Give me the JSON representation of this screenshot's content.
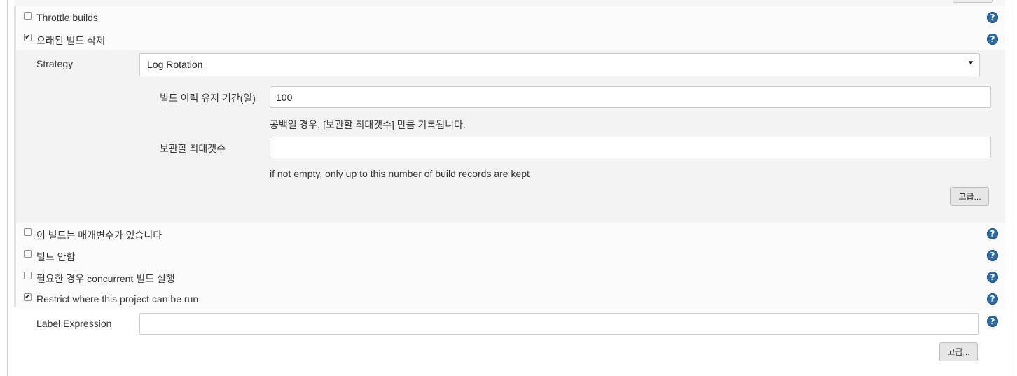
{
  "options": {
    "throttle_builds": {
      "label": "Throttle builds",
      "checked": false
    },
    "discard_old_builds": {
      "label": "오래된 빌드 삭제",
      "checked": true
    },
    "parameterized": {
      "label": "이 빌드는 매개변수가 있습니다",
      "checked": false
    },
    "disable_build": {
      "label": "빌드 안함",
      "checked": false
    },
    "concurrent_builds": {
      "label": "필요한 경우 concurrent 빌드 실행",
      "checked": false
    },
    "restrict_where": {
      "label": "Restrict where this project can be run",
      "checked": true
    }
  },
  "discard": {
    "strategy_label": "Strategy",
    "strategy_value": "Log Rotation",
    "days_label": "빌드 이력 유지 기간(일)",
    "days_value": "100",
    "days_hint": "공백일 경우, [보관할 최대갯수] 만큼 기록됩니다.",
    "max_label": "보관할 최대갯수",
    "max_value": "",
    "max_hint": "if not empty, only up to this number of build records are kept",
    "advanced_label": "고급..."
  },
  "restrict": {
    "label_expression_label": "Label Expression",
    "label_expression_value": "",
    "advanced_label": "고급..."
  },
  "icons": {
    "help": "?",
    "check": "✔",
    "dropdown": "▼"
  },
  "colors": {
    "help_icon": "#2d6aa6"
  }
}
